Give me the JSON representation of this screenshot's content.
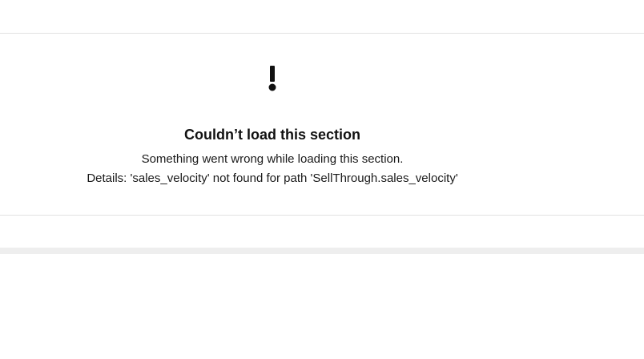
{
  "error": {
    "icon": "exclamation-icon",
    "title": "Couldn’t load this section",
    "message": "Something went wrong while loading this section.",
    "details": "Details: 'sales_velocity' not found for path 'SellThrough.sales_velocity'"
  },
  "colors": {
    "background": "#ffffff",
    "divider": "#e2e2e2",
    "band": "#eeeeee",
    "text": "#1a1a1a",
    "icon": "#111111"
  }
}
